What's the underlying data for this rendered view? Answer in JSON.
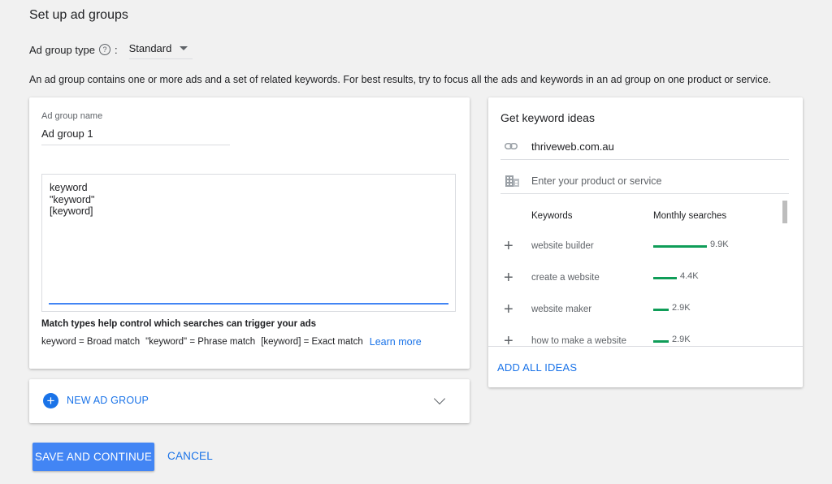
{
  "page": {
    "title": "Set up ad groups",
    "ad_group_type_label": "Ad group type",
    "help_icon": "help-circle-icon",
    "colon": ":",
    "ad_group_type_value": "Standard",
    "description": "An ad group contains one or more ads and a set of related keywords. For best results, try to focus all the ads and keywords in an ad group on one product or service."
  },
  "ad_group_card": {
    "name_label": "Ad group name",
    "name_value": "Ad group 1",
    "keywords_text": "keyword\n\"keyword\"\n[keyword]",
    "match_title": "Match types help control which searches can trigger your ads",
    "match_broad": "keyword = Broad match",
    "match_phrase": "\"keyword\" = Phrase match",
    "match_exact": "[keyword] = Exact match",
    "learn_more": "Learn more"
  },
  "new_ad_group": {
    "label": "NEW AD GROUP",
    "plus_icon": "add-circle-icon",
    "chevron_icon": "chevron-down-icon"
  },
  "keyword_ideas": {
    "title": "Get keyword ideas",
    "url_value": "thriveweb.com.au",
    "product_placeholder": "Enter your product or service",
    "col_keywords": "Keywords",
    "col_monthly": "Monthly searches",
    "bar_color": "#0f9d58",
    "rows": [
      {
        "keyword": "website builder",
        "searches": "9.9K",
        "level": 1.0
      },
      {
        "keyword": "create a website",
        "searches": "4.4K",
        "level": 0.44
      },
      {
        "keyword": "website maker",
        "searches": "2.9K",
        "level": 0.29
      },
      {
        "keyword": "how to make a website",
        "searches": "2.9K",
        "level": 0.29
      }
    ],
    "add_all": "ADD ALL IDEAS"
  },
  "actions": {
    "save": "SAVE AND CONTINUE",
    "cancel": "CANCEL"
  },
  "colors": {
    "primary": "#4285f4",
    "link": "#1a73e8"
  }
}
